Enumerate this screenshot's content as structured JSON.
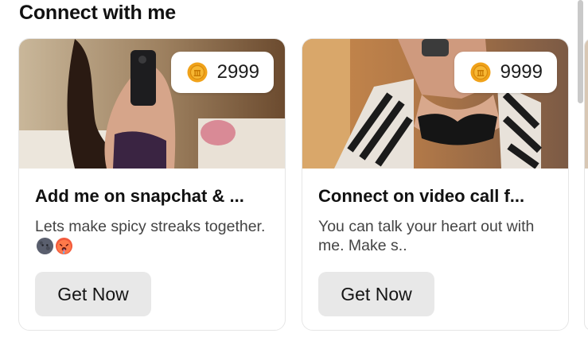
{
  "section": {
    "title": "Connect with me"
  },
  "cards": [
    {
      "price": "2999",
      "title": "Add me on snapchat & ...",
      "description": "Lets make spicy streaks together.",
      "description_emojis": [
        "new-moon-face-emoji",
        "hot-face-emoji"
      ],
      "button_label": "Get Now"
    },
    {
      "price": "9999",
      "title": "Connect on video call f...",
      "description": "You can talk your heart out with me. Make s..",
      "button_label": "Get Now"
    }
  ],
  "colors": {
    "coin": "#f0a21a",
    "button_bg": "#e8e8e8"
  },
  "icons": {
    "price": "coin-icon"
  }
}
